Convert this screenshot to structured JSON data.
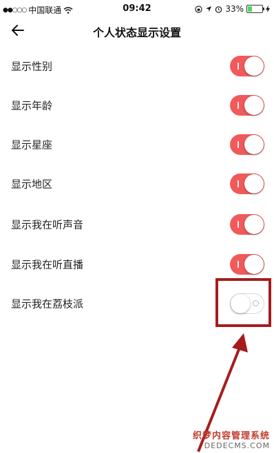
{
  "status_bar": {
    "carrier": "中国联通",
    "time": "09:42",
    "battery": "33%"
  },
  "nav": {
    "title": "个人状态显示设置"
  },
  "settings": [
    {
      "label": "显示性别",
      "on": true
    },
    {
      "label": "显示年龄",
      "on": true
    },
    {
      "label": "显示星座",
      "on": true
    },
    {
      "label": "显示地区",
      "on": true
    },
    {
      "label": "显示我在听声音",
      "on": true
    },
    {
      "label": "显示我在听直播",
      "on": true
    },
    {
      "label": "显示我在荔枝派",
      "on": false
    }
  ],
  "colors": {
    "toggle_on": "#f05a5a",
    "annotation": "#a61c1c"
  },
  "watermark": {
    "line1": "织梦内容管理系统",
    "line2": "DEDECMS.COM"
  }
}
